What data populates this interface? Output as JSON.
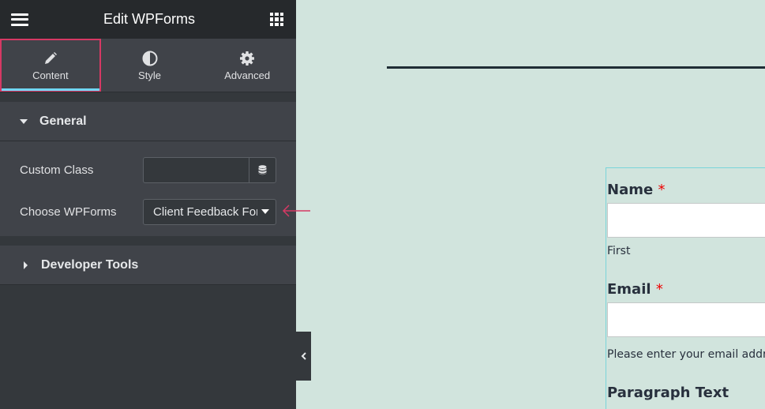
{
  "header": {
    "title": "Edit WPForms",
    "menu_icon": "hamburger-icon",
    "apps_icon": "grid-icon"
  },
  "tabs": [
    {
      "label": "Content",
      "icon": "pencil-icon",
      "active": true
    },
    {
      "label": "Style",
      "icon": "half-circle-icon",
      "active": false
    },
    {
      "label": "Advanced",
      "icon": "gear-icon",
      "active": false
    }
  ],
  "sections": {
    "general": {
      "title": "General",
      "expanded": true,
      "controls": {
        "custom_class": {
          "label": "Custom Class",
          "value": "",
          "placeholder": ""
        },
        "choose_form": {
          "label": "Choose WPForms",
          "value": "Client Feedback Form"
        }
      }
    },
    "developer_tools": {
      "title": "Developer Tools",
      "expanded": false
    }
  },
  "colors": {
    "accent_highlight": "#d63964",
    "active_tab_indicator": "#71d7f7",
    "canvas_bg": "#d1e4dd"
  },
  "preview_form": {
    "fields": [
      {
        "label": "Name",
        "required": true,
        "sublabel": "First"
      },
      {
        "label": "Email",
        "required": true,
        "sublabel": "Please enter your email address"
      },
      {
        "label": "Paragraph Text",
        "required": false
      }
    ],
    "required_marker": "*"
  }
}
